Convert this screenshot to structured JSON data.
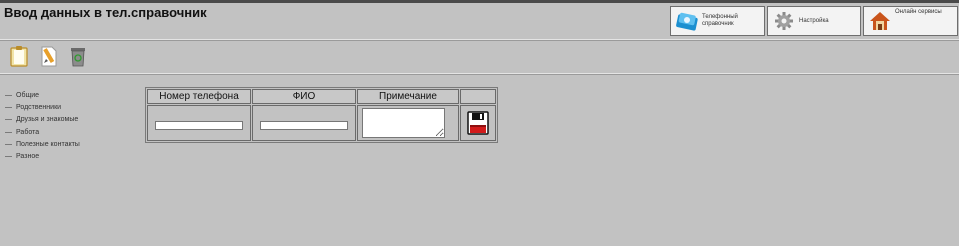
{
  "header": {
    "title": "Ввод данных в тел.справочник"
  },
  "nav": {
    "phonebook_label": "Телефонный\nсправочник",
    "settings_label": "Настройка",
    "online_label": "Онлайн сервисы"
  },
  "toolbar": {
    "icons": [
      "clipboard-icon",
      "edit-pencil-icon",
      "trash-icon"
    ]
  },
  "sidebar": {
    "items": [
      {
        "label": "Общие"
      },
      {
        "label": "Родственники"
      },
      {
        "label": "Друзья и знакомые"
      },
      {
        "label": "Работа"
      },
      {
        "label": "Полезные контакты"
      },
      {
        "label": "Разное"
      }
    ]
  },
  "form": {
    "columns": [
      "Номер телефона",
      "ФИО",
      "Примечание",
      ""
    ],
    "phone_value": "",
    "name_value": "",
    "note_value": ""
  },
  "colors": {
    "background": "#c2c2c2",
    "topbar": "#4a4a4a",
    "button_bg": "#f3f3f3",
    "save_icon_red": "#d21b1b"
  }
}
